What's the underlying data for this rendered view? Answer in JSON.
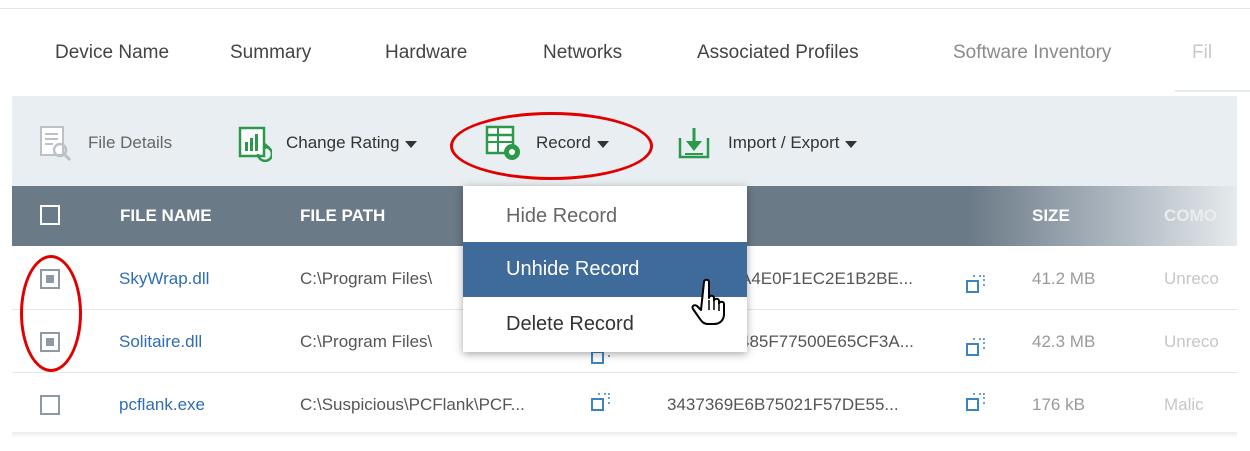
{
  "tabs": [
    {
      "label": "Device Name"
    },
    {
      "label": "Summary"
    },
    {
      "label": "Hardware"
    },
    {
      "label": "Networks"
    },
    {
      "label": "Associated Profiles"
    },
    {
      "label": "Software Inventory"
    },
    {
      "label": "Fil"
    }
  ],
  "toolbar": {
    "file_details": "File Details",
    "change_rating": "Change Rating",
    "record": "Record",
    "import_export": "Import / Export"
  },
  "table": {
    "columns": {
      "file_name": "FILE NAME",
      "file_path": "FILE PATH",
      "size": "SIZE",
      "company": "COMO"
    },
    "rows": [
      {
        "file_name": "SkyWrap.dll",
        "file_path": "C:\\Program Files\\",
        "hash": "A4E0F1EC2E1B2BE...",
        "size": "41.2 MB",
        "company": "Unreco",
        "checked": true
      },
      {
        "file_name": "Solitaire.dll",
        "file_path": "C:\\Program Files\\",
        "hash": "485F77500E65CF3A...",
        "size": "42.3 MB",
        "company": "Unreco",
        "checked": true
      },
      {
        "file_name": "pcflank.exe",
        "file_path": "C:\\Suspicious\\PCFlank\\PCF...",
        "hash": "3437369E6B75021F57DE55...",
        "size": "176 kB",
        "company": "Malic",
        "checked": false
      }
    ]
  },
  "record_menu": {
    "items": [
      {
        "label": "Hide Record",
        "state": "disabled"
      },
      {
        "label": "Unhide Record",
        "state": "hover"
      },
      {
        "label": "Delete Record",
        "state": "normal"
      }
    ]
  },
  "colors": {
    "header_bg": "#6b7a87",
    "toolbar_bg": "#e8eef1",
    "link": "#2e6db4",
    "menu_active": "#3f6b9a",
    "annotation": "#e10000"
  },
  "icons": {
    "file_details": "file-details-icon",
    "change_rating": "change-rating-icon",
    "record": "record-icon",
    "import_export": "import-export-icon",
    "copy": "copy-icon",
    "cursor": "hand-cursor-icon"
  }
}
